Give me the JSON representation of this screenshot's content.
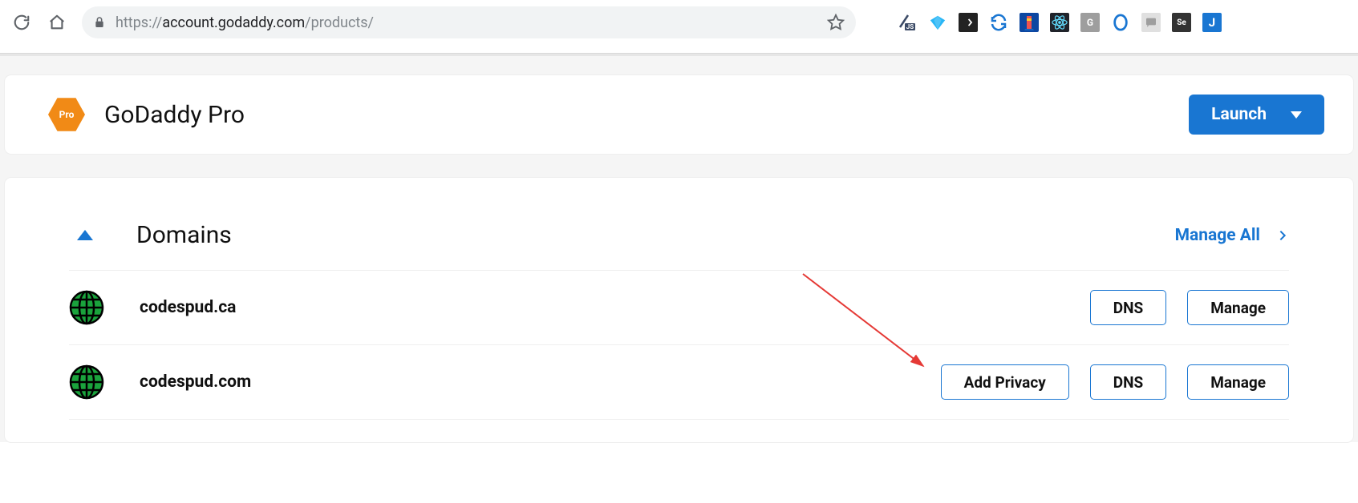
{
  "browser": {
    "url_scheme": "https://",
    "url_host": "account.godaddy.com",
    "url_path": "/products/"
  },
  "card_pro": {
    "badge_text": "Pro",
    "title": "GoDaddy Pro",
    "launch_label": "Launch"
  },
  "domains_section": {
    "title": "Domains",
    "manage_all_label": "Manage All",
    "rows": [
      {
        "name": "codespud.ca",
        "add_privacy_label": null,
        "dns_label": "DNS",
        "manage_label": "Manage"
      },
      {
        "name": "codespud.com",
        "add_privacy_label": "Add Privacy",
        "dns_label": "DNS",
        "manage_label": "Manage"
      }
    ]
  },
  "extensions": [
    {
      "name": "js-extension",
      "bg": "#ffffff",
      "fg": "#3b4a66"
    },
    {
      "name": "gem-extension",
      "bg": "#ffffff",
      "fg": "#2196f3"
    },
    {
      "name": "code-extension",
      "bg": "#222",
      "fg": "#fff"
    },
    {
      "name": "sync-extension",
      "bg": "#fff",
      "fg": "#1976d2"
    },
    {
      "name": "lighthouse-extension",
      "bg": "#1565c0",
      "fg": "#fff"
    },
    {
      "name": "react-extension",
      "bg": "#20232a",
      "fg": "#61dafb"
    },
    {
      "name": "grammarly-extension",
      "bg": "#9e9e9e",
      "fg": "#fff"
    },
    {
      "name": "opera-extension",
      "bg": "#fff",
      "fg": "#1976d2"
    },
    {
      "name": "chat-extension",
      "bg": "#e0e0e0",
      "fg": "#777"
    },
    {
      "name": "selenium-extension",
      "bg": "#333",
      "fg": "#fff"
    },
    {
      "name": "j-extension",
      "bg": "#1976d2",
      "fg": "#fff"
    }
  ]
}
